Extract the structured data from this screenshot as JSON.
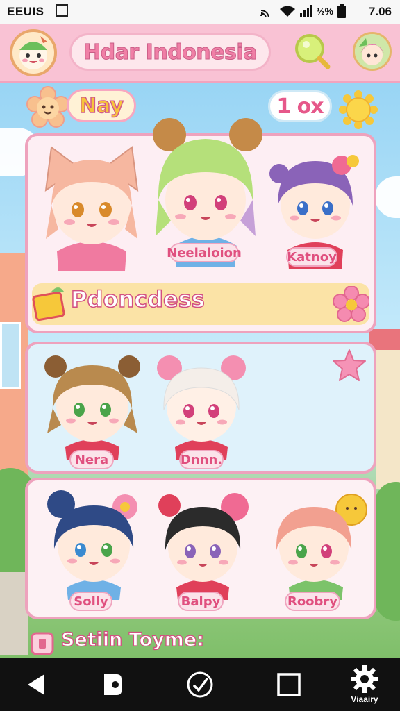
{
  "statusbar": {
    "carrier": "EEUIS",
    "battery_text": "½%",
    "time": "7.06"
  },
  "header": {
    "title": "Hdar Indonesia"
  },
  "profile": {
    "name": "Nay",
    "count": "1 ox"
  },
  "panel1": {
    "characters": [
      {
        "name": "",
        "hair": "#f6b7a0",
        "ears": "cat"
      },
      {
        "name": "Neelaloion",
        "hair": "#b5e07a",
        "ears": "buns"
      },
      {
        "name": "Katnoy",
        "hair": "#8a63b8",
        "ears": "bow"
      }
    ],
    "banner": "Pdoncdess"
  },
  "panel2": {
    "characters": [
      {
        "name": "Nera",
        "hair": "#b98a4e",
        "ears": "bear"
      },
      {
        "name": "Dnnn.",
        "hair": "#f4eee9",
        "ears": "buns"
      }
    ]
  },
  "panel3": {
    "characters": [
      {
        "name": "Solly",
        "hair": "#2f4a86",
        "ears": "buns"
      },
      {
        "name": "Balpy",
        "hair": "#2b2b2b",
        "ears": "bow"
      },
      {
        "name": "Roobry",
        "hair": "#f2a090",
        "ears": "flower"
      }
    ]
  },
  "footer": {
    "label": "Setiin Toyme:"
  },
  "navbar": {
    "items": [
      {
        "icon": "back-icon",
        "label": ""
      },
      {
        "icon": "home-icon",
        "label": ""
      },
      {
        "icon": "check-icon",
        "label": ""
      },
      {
        "icon": "square-icon",
        "label": ""
      },
      {
        "icon": "gear-icon",
        "label": "Viaairy"
      }
    ]
  },
  "colors": {
    "accent_pink": "#f07fa6",
    "topbar": "#f9c2d4"
  }
}
